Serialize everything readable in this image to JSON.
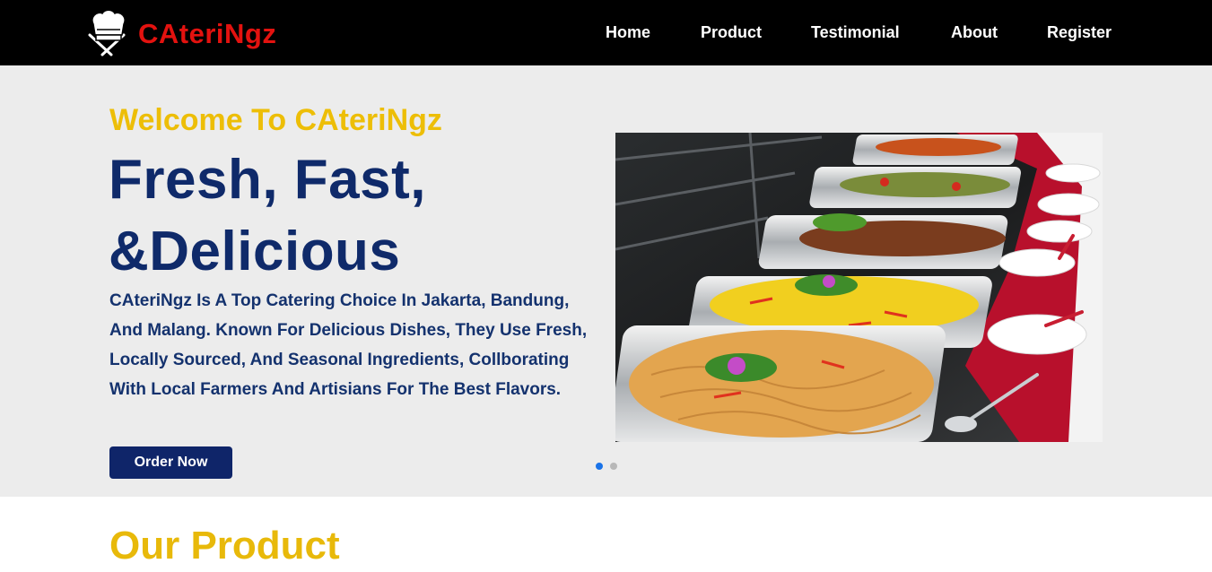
{
  "brand": {
    "name": "CAteriNgz",
    "logo_icon": "chef-hat-utensils-icon",
    "color": "#e3120f"
  },
  "nav": {
    "items": [
      {
        "label": "Home"
      },
      {
        "label": "Product"
      },
      {
        "label": "Testimonial"
      },
      {
        "label": "About"
      },
      {
        "label": "Register"
      }
    ]
  },
  "hero": {
    "welcome": "Welcome To CAteriNgz",
    "heading": "Fresh, Fast, &Delicious",
    "description": "CAteriNgz Is A Top Catering Choice In Jakarta, Bandung, And Malang. Known For Delicious Dishes, They Use Fresh, Locally Sourced, And Seasonal Ingredients, Collborating With Local Farmers And Artisians For The Best Flavors.",
    "cta_label": "Order Now",
    "image_subject": "buffet-trays-photo",
    "carousel": {
      "slide_count": 2,
      "active_slide": 1
    }
  },
  "products": {
    "title": "Our Product"
  },
  "colors": {
    "navbar_bg": "#000000",
    "hero_bg": "#ececec",
    "accent_yellow": "#edbe07",
    "navy": "#0f2a6a",
    "button_bg": "#0f2569"
  }
}
